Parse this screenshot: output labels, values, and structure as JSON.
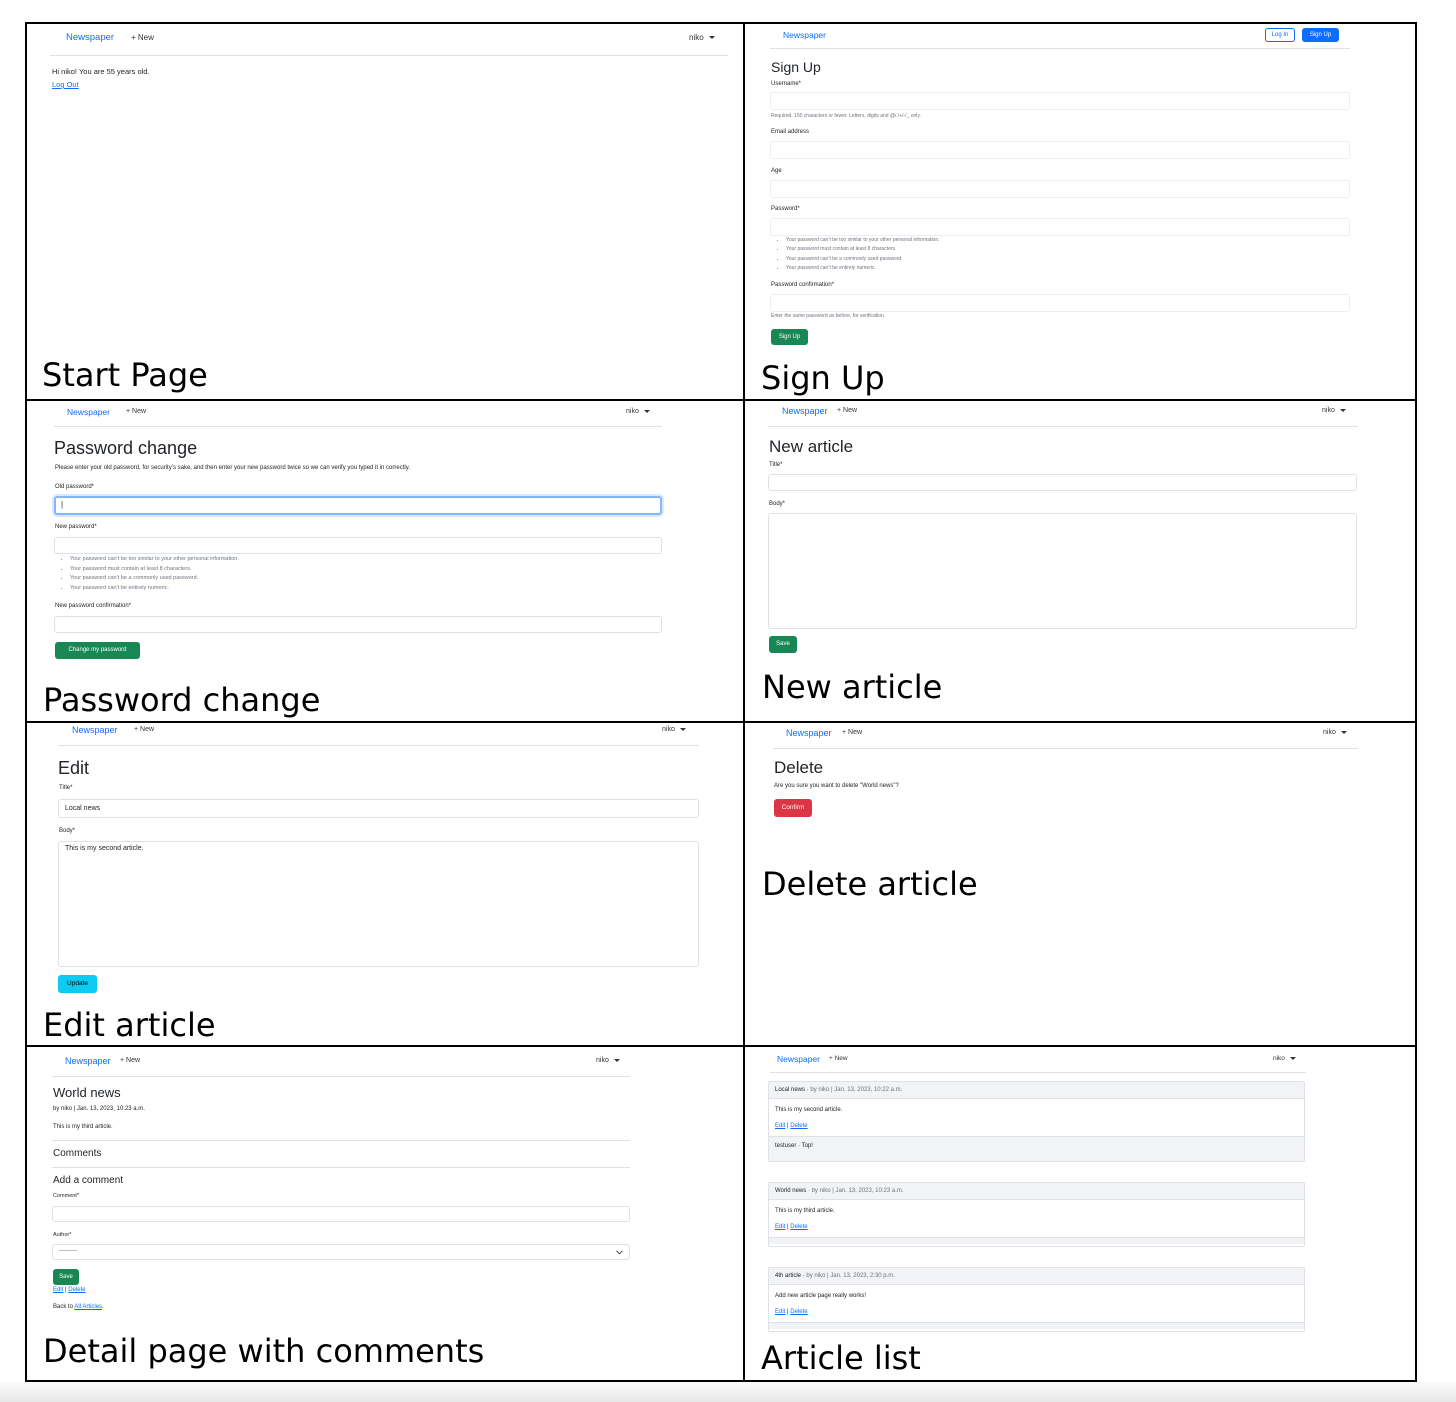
{
  "nav": {
    "brand": "Newspaper",
    "new": "+ New",
    "user": "niko",
    "login": "Log In",
    "signup": "Sign Up"
  },
  "captions": {
    "start": "Start Page",
    "signup": "Sign Up",
    "password": "Password change",
    "new_article": "New article",
    "edit": "Edit article",
    "delete": "Delete article",
    "detail": "Detail page with comments",
    "list": "Article list"
  },
  "start": {
    "greeting": "Hi niko! You are 55 years old.",
    "logout": "Log Out"
  },
  "signup": {
    "title": "Sign Up",
    "username_label": "Username*",
    "username_help": "Required. 150 characters or fewer. Letters, digits and @/./+/-/_ only.",
    "email_label": "Email address",
    "age_label": "Age",
    "password_label": "Password*",
    "password_rules": [
      "Your password can’t be too similar to your other personal information.",
      "Your password must contain at least 8 characters.",
      "Your password can’t be a commonly used password.",
      "Your password can’t be entirely numeric."
    ],
    "confirm_label": "Password confirmation*",
    "confirm_help": "Enter the same password as before, for verification.",
    "button": "Sign Up"
  },
  "password_change": {
    "title": "Password change",
    "intro": "Please enter your old password, for security’s sake, and then enter your new password twice so we can verify you typed it in correctly.",
    "old_label": "Old password*",
    "old_value": "|",
    "new_label": "New password*",
    "rules": [
      "Your password can’t be too similar to your other personal information.",
      "Your password must contain at least 8 characters.",
      "Your password can’t be a commonly used password.",
      "Your password can’t be entirely numeric."
    ],
    "confirm_label": "New password confirmation*",
    "button": "Change my password"
  },
  "new_article": {
    "title": "New article",
    "title_label": "Title*",
    "body_label": "Body*",
    "button": "Save"
  },
  "edit": {
    "title": "Edit",
    "title_label": "Title*",
    "title_value": "Local news",
    "body_label": "Body*",
    "body_value": "This is my second article.",
    "button": "Update"
  },
  "delete": {
    "title": "Delete",
    "question": "Are you sure you want to delete \"World news\"?",
    "button": "Confirm"
  },
  "detail": {
    "title": "World news",
    "meta": "by niko | Jan. 13, 2023, 10:23 a.m.",
    "body": "This is my third article.",
    "comments_heading": "Comments",
    "add_heading": "Add a comment",
    "comment_label": "Comment*",
    "author_label": "Author*",
    "author_value": "---------",
    "button": "Save",
    "edit": "Edit",
    "sep": "|",
    "delete": "Delete",
    "back_prefix": "Back to",
    "back_link": "All Articles",
    "back_suffix": "."
  },
  "list": {
    "articles": [
      {
        "title": "Local news",
        "meta": "· by niko | Jan. 13, 2023, 10:22 a.m.",
        "body": "This is my second article.",
        "edit": "Edit",
        "delete": "Delete",
        "comment": "testuser · Top!"
      },
      {
        "title": "World news",
        "meta": "· by niko | Jan. 13, 2023, 10:23 a.m.",
        "body": "This is my third article.",
        "edit": "Edit",
        "delete": "Delete",
        "comment": ""
      },
      {
        "title": "4th article",
        "meta": "· by niko | Jan. 13, 2023, 2:30 p.m.",
        "body": "Add new article page really works!",
        "edit": "Edit",
        "delete": "Delete",
        "comment": ""
      }
    ],
    "sep": "|"
  },
  "colors": {
    "brand": "#0d6efd",
    "success": "#198754",
    "info": "#0dcaf0",
    "danger": "#dc3545"
  }
}
